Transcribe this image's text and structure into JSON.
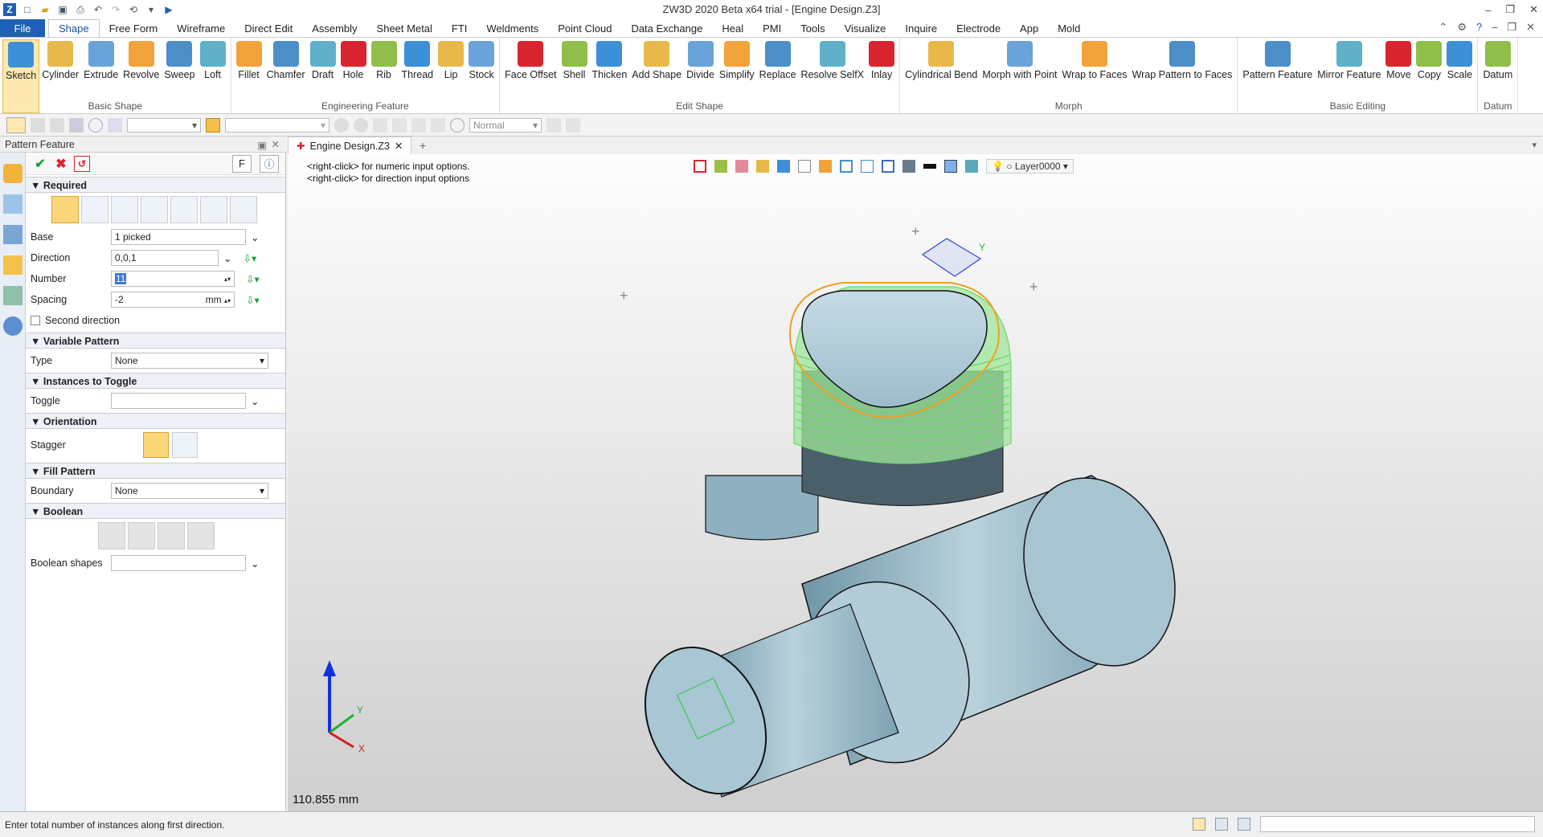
{
  "window": {
    "title": "ZW3D 2020 Beta x64 trial - [Engine Design.Z3]"
  },
  "menu": {
    "tabs": [
      "File",
      "Shape",
      "Free Form",
      "Wireframe",
      "Direct Edit",
      "Assembly",
      "Sheet Metal",
      "FTI",
      "Weldments",
      "Point Cloud",
      "Data Exchange",
      "Heal",
      "PMI",
      "Tools",
      "Visualize",
      "Inquire",
      "Electrode",
      "App",
      "Mold"
    ],
    "active": "Shape"
  },
  "ribbon": {
    "groups": [
      {
        "label": "Basic Shape",
        "buttons": [
          "Sketch",
          "Cylinder",
          "Extrude",
          "Revolve",
          "Sweep",
          "Loft"
        ]
      },
      {
        "label": "Engineering Feature",
        "buttons": [
          "Fillet",
          "Chamfer",
          "Draft",
          "Hole",
          "Rib",
          "Thread",
          "Lip",
          "Stock"
        ]
      },
      {
        "label": "Edit Shape",
        "buttons": [
          "Face Offset",
          "Shell",
          "Thicken",
          "Add Shape",
          "Divide",
          "Simplify",
          "Replace",
          "Resolve SelfX",
          "Inlay"
        ]
      },
      {
        "label": "Morph",
        "buttons": [
          "Cylindrical Bend",
          "Morph with Point",
          "Wrap to Faces",
          "Wrap Pattern to Faces"
        ]
      },
      {
        "label": "Basic Editing",
        "buttons": [
          "Pattern Feature",
          "Mirror Feature",
          "Move",
          "Copy",
          "Scale"
        ]
      },
      {
        "label": "Datum",
        "buttons": [
          "Datum"
        ]
      }
    ]
  },
  "toolbar": {
    "render_mode": "Normal"
  },
  "panel": {
    "title": "Pattern Feature",
    "f_button": "F",
    "sections": {
      "required": "Required",
      "variable": "Variable Pattern",
      "instances": "Instances to Toggle",
      "orientation": "Orientation",
      "fill": "Fill Pattern",
      "boolean": "Boolean"
    },
    "fields": {
      "base_label": "Base",
      "base_value": "1 picked",
      "direction_label": "Direction",
      "direction_value": "0,0,1",
      "number_label": "Number",
      "number_value": "11",
      "spacing_label": "Spacing",
      "spacing_value": "-2",
      "spacing_unit": "mm",
      "second_direction": "Second direction",
      "type_label": "Type",
      "type_value": "None",
      "toggle_label": "Toggle",
      "stagger_label": "Stagger",
      "boundary_label": "Boundary",
      "boundary_value": "None",
      "boolean_shapes_label": "Boolean shapes"
    }
  },
  "viewport": {
    "tab": "Engine Design.Z3",
    "hint1": "<right-click> for numeric input options.",
    "hint2": "<right-click> for direction input options",
    "layer": "Layer0000",
    "measure": "110.855 mm",
    "axis_x": "X",
    "axis_y": "Y",
    "axis_z": "Z"
  },
  "status": {
    "message": "Enter total number of instances along first direction."
  },
  "colors": {
    "accent": "#1e5fb8",
    "pattern_green": "#7de07a",
    "highlight": "#f0a020",
    "part": "#9fbfcc"
  }
}
